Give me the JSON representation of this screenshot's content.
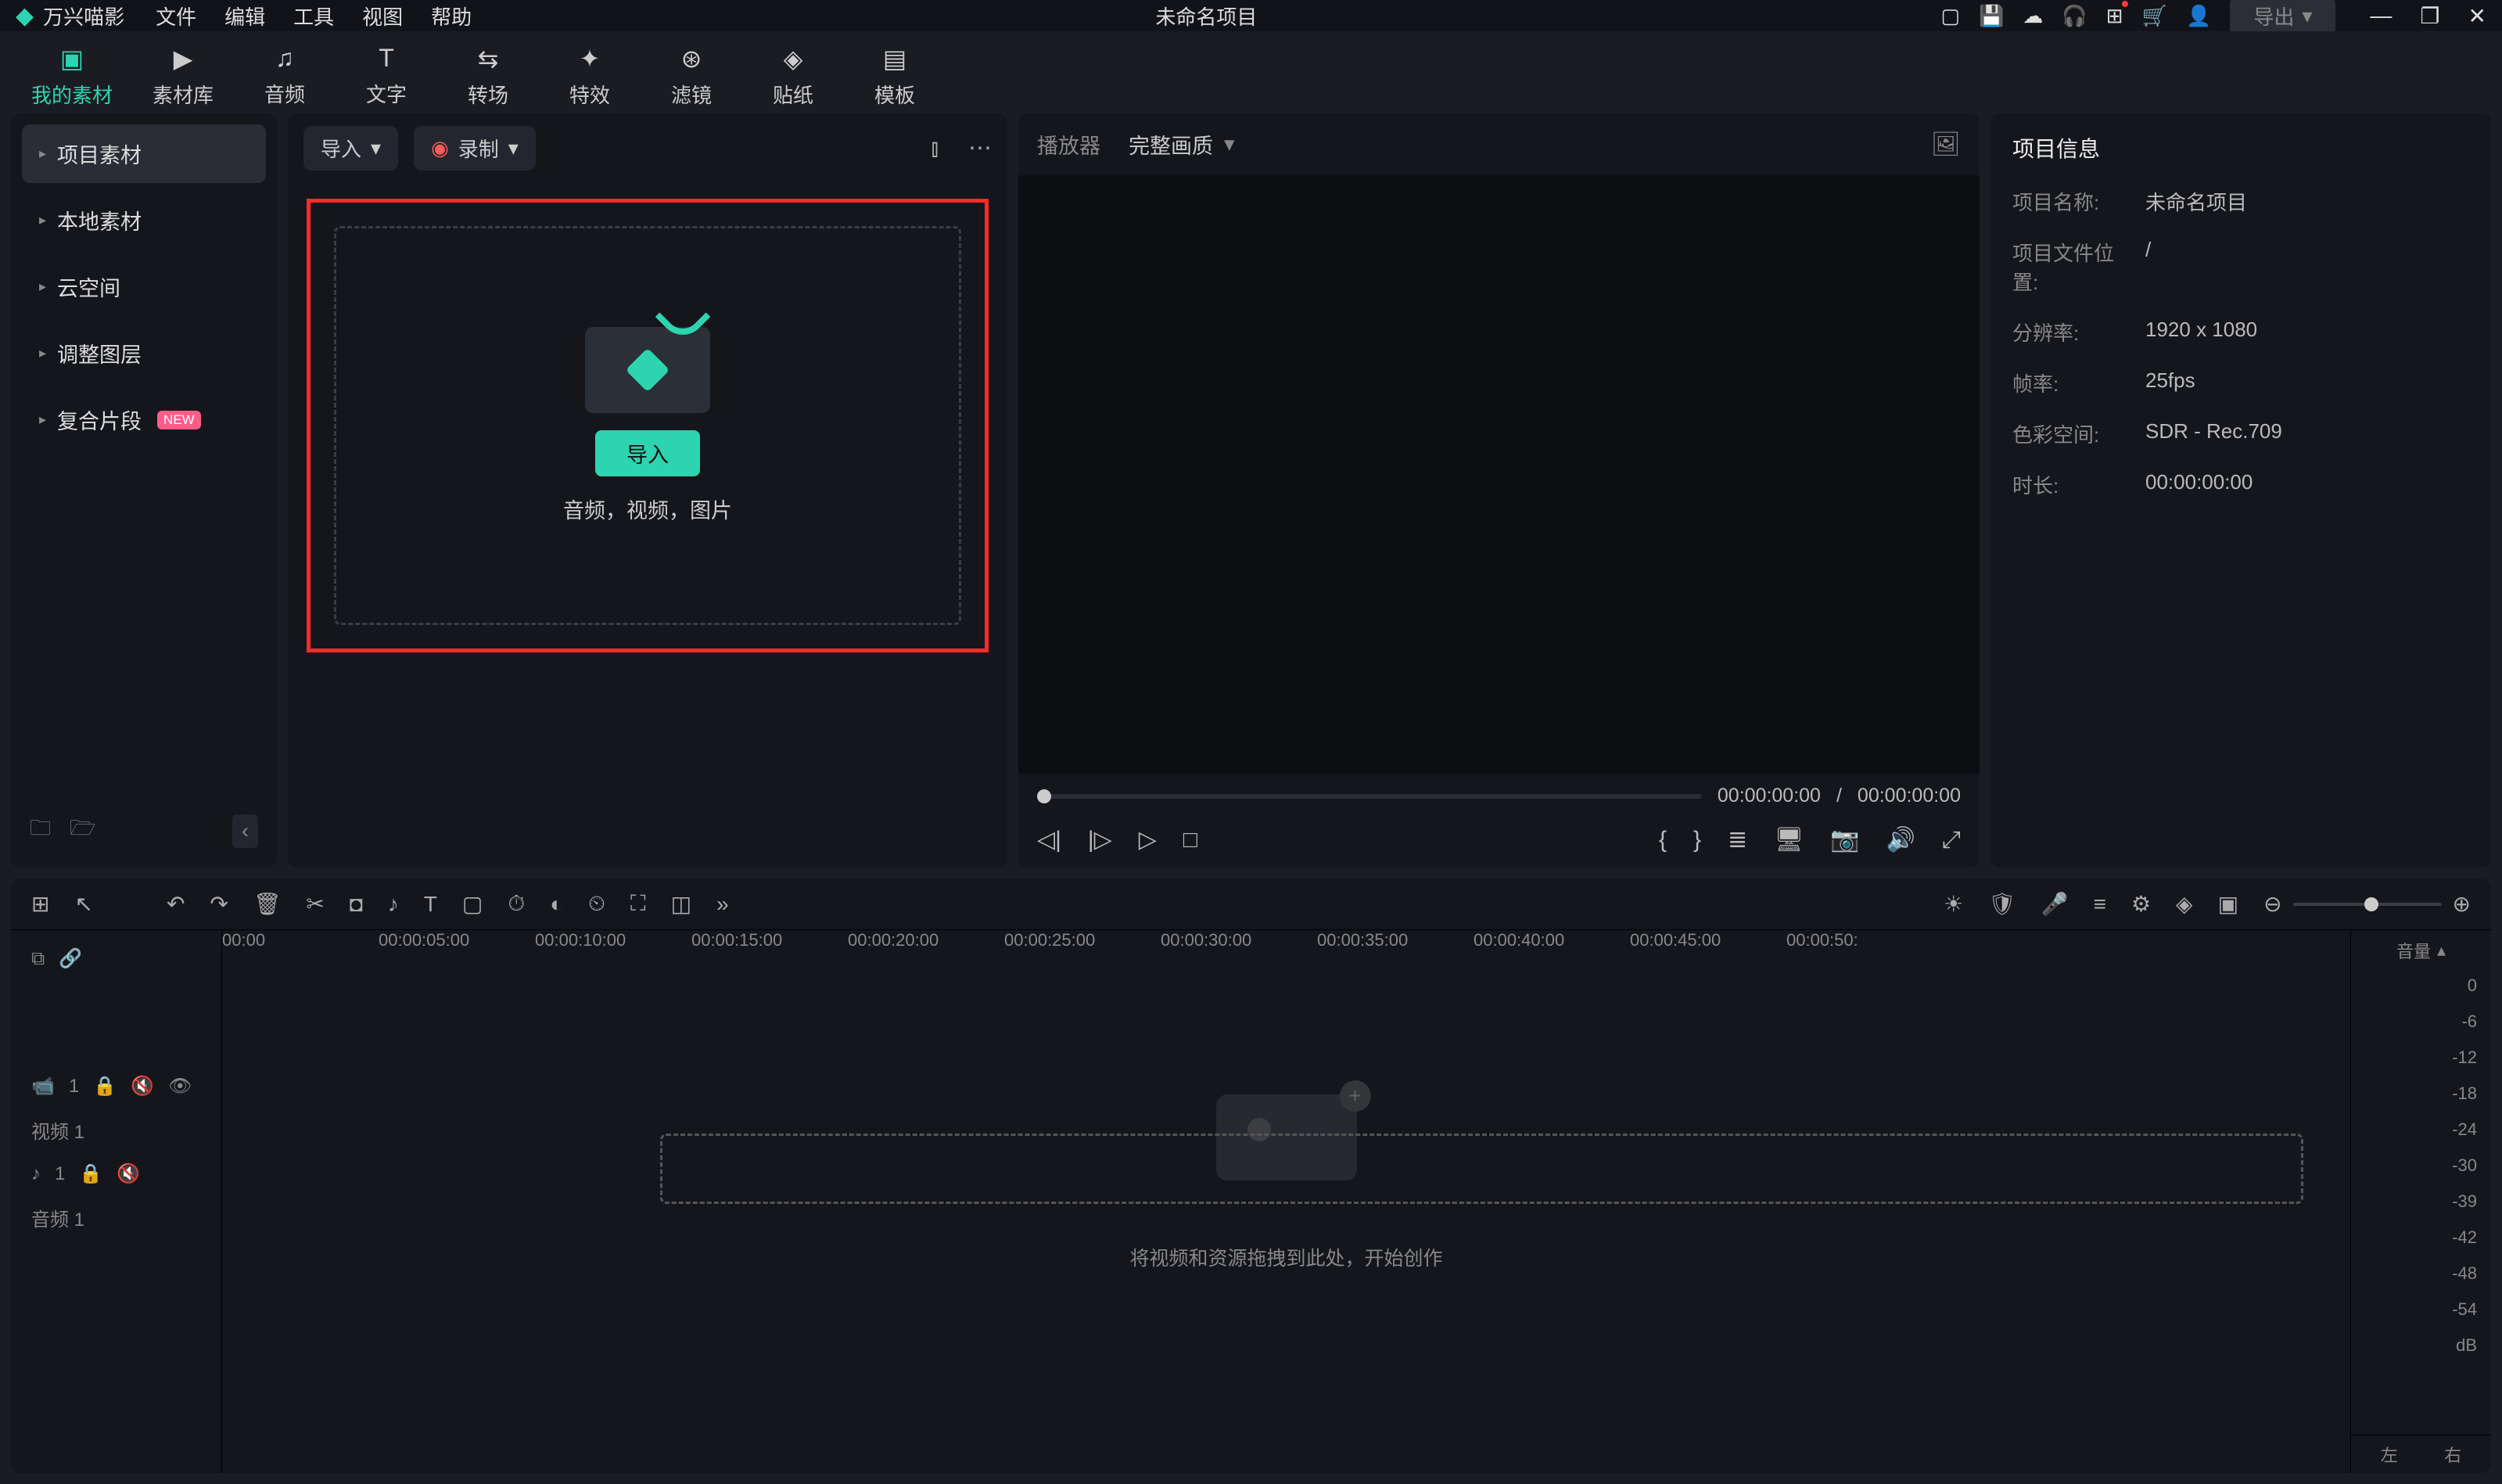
{
  "title_bar": {
    "brand": "万兴喵影",
    "menus": [
      "文件",
      "编辑",
      "工具",
      "视图",
      "帮助"
    ],
    "project": "未命名项目",
    "export": "导出"
  },
  "top_tabs": [
    {
      "icon": "▣",
      "label": "我的素材",
      "active": true
    },
    {
      "icon": "▶",
      "label": "素材库"
    },
    {
      "icon": "♫",
      "label": "音频"
    },
    {
      "icon": "T",
      "label": "文字"
    },
    {
      "icon": "⇆",
      "label": "转场"
    },
    {
      "icon": "✦",
      "label": "特效"
    },
    {
      "icon": "⊛",
      "label": "滤镜"
    },
    {
      "icon": "◈",
      "label": "贴纸"
    },
    {
      "icon": "▤",
      "label": "模板"
    }
  ],
  "sidebar": {
    "items": [
      {
        "label": "项目素材",
        "active": true
      },
      {
        "label": "本地素材"
      },
      {
        "label": "云空间"
      },
      {
        "label": "调整图层"
      },
      {
        "label": "复合片段",
        "new": "NEW"
      }
    ]
  },
  "media": {
    "import": "导入",
    "record": "录制",
    "import_btn": "导入",
    "hint": "音频，视频，图片"
  },
  "player": {
    "label": "播放器",
    "quality": "完整画质",
    "cur": "00:00:00:00",
    "sep": "/",
    "total": "00:00:00:00"
  },
  "info": {
    "title": "项目信息",
    "name_l": "项目名称:",
    "name_v": "未命名项目",
    "path_l": "项目文件位置:",
    "path_v": "/",
    "res_l": "分辨率:",
    "res_v": "1920 x 1080",
    "fps_l": "帧率:",
    "fps_v": "25fps",
    "color_l": "色彩空间:",
    "color_v": "SDR - Rec.709",
    "dur_l": "时长:",
    "dur_v": "00:00:00:00"
  },
  "timeline": {
    "ruler": [
      "00:00",
      "00:00:05:00",
      "00:00:10:00",
      "00:00:15:00",
      "00:00:20:00",
      "00:00:25:00",
      "00:00:30:00",
      "00:00:35:00",
      "00:00:40:00",
      "00:00:45:00",
      "00:00:50:"
    ],
    "tracks": {
      "video": "视频 1",
      "audio": "音频 1"
    },
    "msg": "将视频和资源拖拽到此处，开始创作",
    "vol": "音量",
    "db_scale": [
      "0",
      "-6",
      "-12",
      "-18",
      "-24",
      "-30",
      "-39",
      "-42",
      "-48",
      "-54"
    ],
    "db": "dB",
    "left": "左",
    "right": "右"
  }
}
